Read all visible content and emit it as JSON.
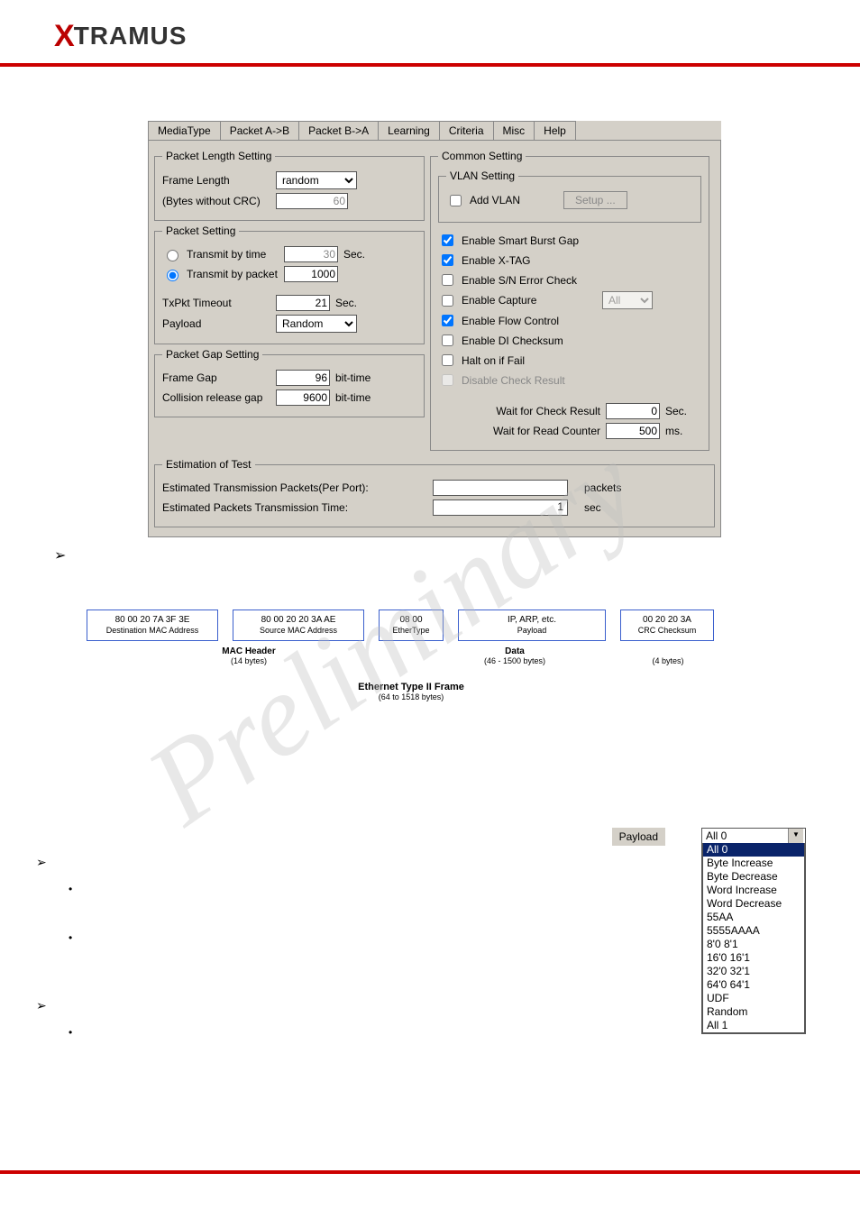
{
  "brand": "XTRAMUS",
  "tabs": [
    "MediaType",
    "Packet A->B",
    "Packet B->A",
    "Learning",
    "Criteria",
    "Misc",
    "Help"
  ],
  "activeTab": 1,
  "pls": {
    "legend": "Packet Length Setting",
    "frameLengthLabel": "Frame Length",
    "frameLengthValue": "random",
    "noteLabel": "(Bytes without CRC)",
    "bytesValue": "60"
  },
  "ps": {
    "legend": "Packet Setting",
    "byTimeLabel": "Transmit by time",
    "byTimeValue": "30",
    "byTimeUnit": "Sec.",
    "byPacketLabel": "Transmit by packet",
    "byPacketValue": "1000",
    "txTimeoutLabel": "TxPkt Timeout",
    "txTimeoutValue": "21",
    "txTimeoutUnit": "Sec.",
    "payloadLabel": "Payload",
    "payloadValue": "Random"
  },
  "pgs": {
    "legend": "Packet Gap Setting",
    "frameGapLabel": "Frame Gap",
    "frameGapValue": "96",
    "frameGapUnit": "bit-time",
    "collLabel": "Collision release gap",
    "collValue": "9600",
    "collUnit": "bit-time"
  },
  "cs": {
    "legend": "Common Setting",
    "vlanLegend": "VLAN Setting",
    "addVlanLabel": "Add VLAN",
    "setupLabel": "Setup ...",
    "chk1": "Enable Smart Burst Gap",
    "chk2": "Enable X-TAG",
    "chk3": "Enable S/N Error Check",
    "chk4": "Enable Capture",
    "captureSel": "All",
    "chk5": "Enable Flow Control",
    "chk6": "Enable DI Checksum",
    "chk7": "Halt on if Fail",
    "chk8": "Disable Check Result",
    "waitCheckLabel": "Wait for Check Result",
    "waitCheckValue": "0",
    "waitCheckUnit": "Sec.",
    "waitReadLabel": "Wait for Read Counter",
    "waitReadValue": "500",
    "waitReadUnit": "ms."
  },
  "est": {
    "legend": "Estimation of Test",
    "r1label": "Estimated Transmission Packets(Per Port):",
    "r1val": "",
    "r1unit": "packets",
    "r2label": "Estimated Packets Transmission Time:",
    "r2val": "1",
    "r2unit": "sec"
  },
  "frame": {
    "b1top": "80 00 20 7A 3F 3E",
    "b1bot": "Destination MAC Address",
    "b2top": "80 00 20 20 3A AE",
    "b2bot": "Source MAC Address",
    "b3top": "08 00",
    "b3bot": "EtherType",
    "b4top": "IP, ARP, etc.",
    "b4bot": "Payload",
    "b5top": "00 20 20 3A",
    "b5bot": "CRC Checksum",
    "s1": "MAC Header",
    "s1sub": "(14 bytes)",
    "s2": "Data",
    "s2sub": "(46 - 1500 bytes)",
    "s3sub": "(4 bytes)",
    "bottom": "Ethernet Type II Frame",
    "bottomsub": "(64 to 1518 bytes)"
  },
  "pf": {
    "label": "Payload",
    "selected": "All 0",
    "options": [
      "All 0",
      "Byte Increase",
      "Byte Decrease",
      "Word Increase",
      "Word Decrease",
      "55AA",
      "5555AAAA",
      "8'0 8'1",
      "16'0 16'1",
      "32'0 32'1",
      "64'0 64'1",
      "UDF",
      "Random",
      "All 1"
    ]
  },
  "watermark": "Preliminary"
}
